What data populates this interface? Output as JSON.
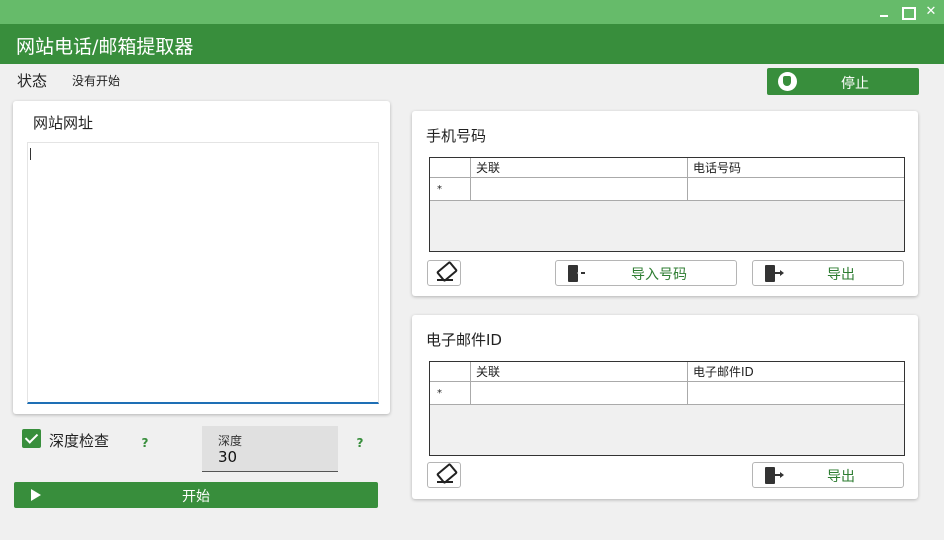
{
  "window": {
    "title": "网站电话/邮箱提取器",
    "min_icon": "minimize-icon",
    "max_icon": "maximize-icon",
    "close_glyph": "✕"
  },
  "status": {
    "label": "状态",
    "value": "没有开始"
  },
  "stop_button": {
    "label": "停止",
    "icon": "hand-stop-icon"
  },
  "url_panel": {
    "title": "网站网址",
    "value": ""
  },
  "depth_check": {
    "label": "深度检查",
    "checked": true,
    "help": "?"
  },
  "depth": {
    "label": "深度",
    "value": "30",
    "help": "?"
  },
  "start_button": {
    "label": "开始",
    "icon": "play-icon"
  },
  "phone_panel": {
    "title": "手机号码",
    "columns": [
      "",
      "关联",
      "电话号码"
    ],
    "new_row_marker": "*",
    "eraser_icon": "eraser-icon",
    "import_label": "导入号码",
    "export_label": "导出"
  },
  "email_panel": {
    "title": "电子邮件ID",
    "columns": [
      "",
      "关联",
      "电子邮件ID"
    ],
    "new_row_marker": "*",
    "eraser_icon": "eraser-icon",
    "export_label": "导出"
  },
  "colors": {
    "titlebar": "#66bb6a",
    "header": "#388e3c",
    "accent": "#388e3c",
    "input_underline": "#1e6fb5"
  }
}
